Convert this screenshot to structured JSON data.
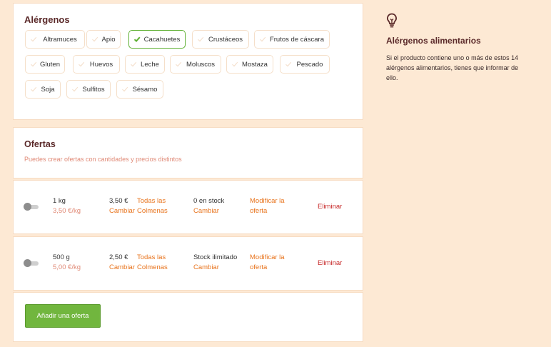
{
  "allergens": {
    "title": "Alérgenos",
    "items": [
      {
        "label": "Altramuces",
        "selected": false
      },
      {
        "label": "Apio",
        "selected": false
      },
      {
        "label": "Cacahuetes",
        "selected": true
      },
      {
        "label": "Crustáceos",
        "selected": false
      },
      {
        "label": "Frutos de cáscara",
        "selected": false
      },
      {
        "label": "Gluten",
        "selected": false
      },
      {
        "label": "Huevos",
        "selected": false
      },
      {
        "label": "Leche",
        "selected": false
      },
      {
        "label": "Moluscos",
        "selected": false
      },
      {
        "label": "Mostaza",
        "selected": false
      },
      {
        "label": "Pescado",
        "selected": false
      },
      {
        "label": "Soja",
        "selected": false
      },
      {
        "label": "Sulfitos",
        "selected": false
      },
      {
        "label": "Sésamo",
        "selected": false
      }
    ]
  },
  "offers": {
    "title": "Ofertas",
    "subtitle": "Puedes crear ofertas con cantidades y precios distintos",
    "rows": [
      {
        "quantity": "1 kg",
        "unit_price": "3,50 €/kg",
        "price": "3,50 €",
        "price_action": "Cambiar",
        "hives_line1": "Todas las",
        "hives_line2": "Colmenas",
        "stock": "0 en stock",
        "stock_action": "Cambiar",
        "modify_line1": "Modificar la",
        "modify_line2": "oferta",
        "delete": "Eliminar",
        "enabled": false
      },
      {
        "quantity": "500 g",
        "unit_price": "5,00 €/kg",
        "price": "2,50 €",
        "price_action": "Cambiar",
        "hives_line1": "Todas las",
        "hives_line2": "Colmenas",
        "stock": "Stock ilimitado",
        "stock_action": "Cambiar",
        "modify_line1": "Modificar la",
        "modify_line2": "oferta",
        "delete": "Eliminar",
        "enabled": false
      }
    ],
    "add_button": "Añadir una oferta"
  },
  "info": {
    "icon": "lightbulb-icon",
    "title": "Alérgenos alimentarios",
    "text": "Si el producto contiene uno o más de estos 14 alérgenos alimentarios, tienes que informar de ello."
  },
  "colors": {
    "background": "#fde9d4",
    "accent_green": "#71b63e",
    "link_orange": "#e8731c",
    "danger_red": "#c72a2a",
    "title_brown": "#5b2a2a"
  }
}
